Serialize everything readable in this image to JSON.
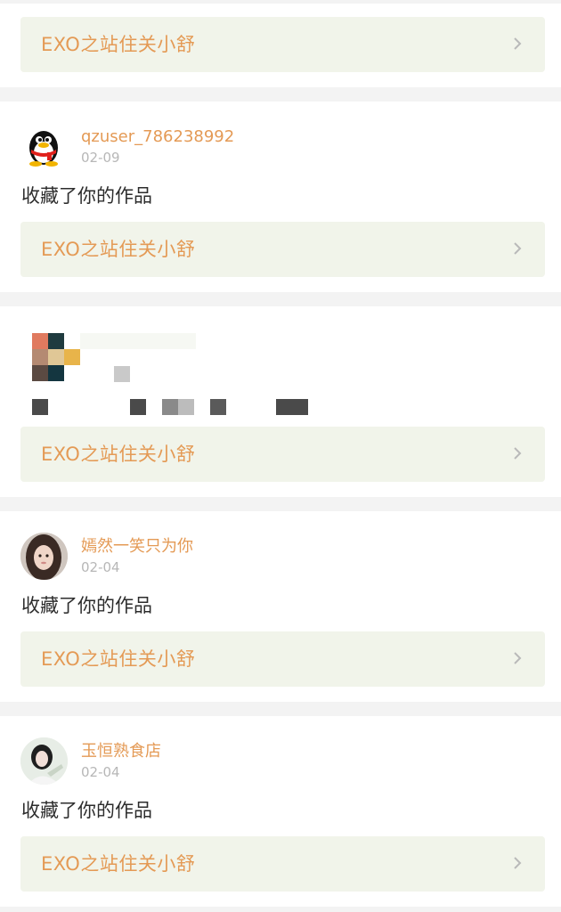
{
  "notifications": [
    {
      "link_label": "EXO之站住关小舒"
    },
    {
      "username": "qzuser_786238992",
      "date": "02-09",
      "action": "收藏了你的作品",
      "avatar_icon": "qq-penguin-icon",
      "link_label": "EXO之站住关小舒"
    },
    {
      "link_label": "EXO之站住关小舒"
    },
    {
      "username": "嫣然一笑只为你",
      "date": "02-04",
      "action": "收藏了你的作品",
      "link_label": "EXO之站住关小舒"
    },
    {
      "username": "玉恒熟食店",
      "date": "02-04",
      "action": "收藏了你的作品",
      "link_label": "EXO之站住关小舒"
    }
  ],
  "colors": {
    "accent": "#e49a55",
    "link_bg": "#f1f4ea",
    "date": "#b7b7b7",
    "text": "#2c2c2c",
    "separator": "#f3f3f3"
  },
  "icons": {
    "chevron": "chevron-right-icon"
  }
}
